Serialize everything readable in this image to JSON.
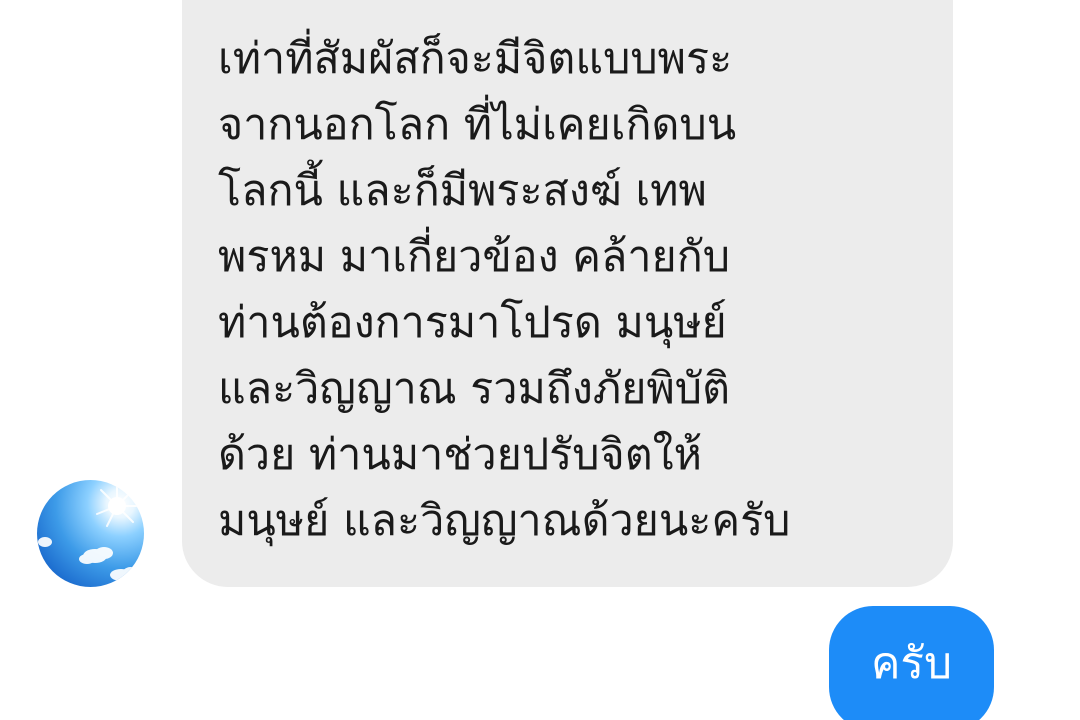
{
  "conversation": {
    "incoming_message": {
      "text": "เท่าที่สัมผัสก็จะมีจิตแบบพระ\nจากนอกโลก ที่ไม่เคยเกิดบน\nโลกนี้ และก็มีพระสงฆ์ เทพ\nพรหม มาเกี่ยวข้อง คล้ายกับ\nท่านต้องการมาโปรด มนุษย์\nและวิญญาณ รวมถึงภัยพิบัติ\nด้วย ท่านมาช่วยปรับจิตให้\nมนุษย์ และวิญญาณด้วยนะครับ",
      "avatar_icon": "sky-sun-avatar-icon"
    },
    "outgoing_message": {
      "text": "ครับ"
    }
  },
  "colors": {
    "incoming_bubble": "#ececec",
    "outgoing_bubble": "#1d8cf8",
    "incoming_text": "#1a1a1a",
    "outgoing_text": "#ffffff",
    "background": "#ffffff"
  }
}
